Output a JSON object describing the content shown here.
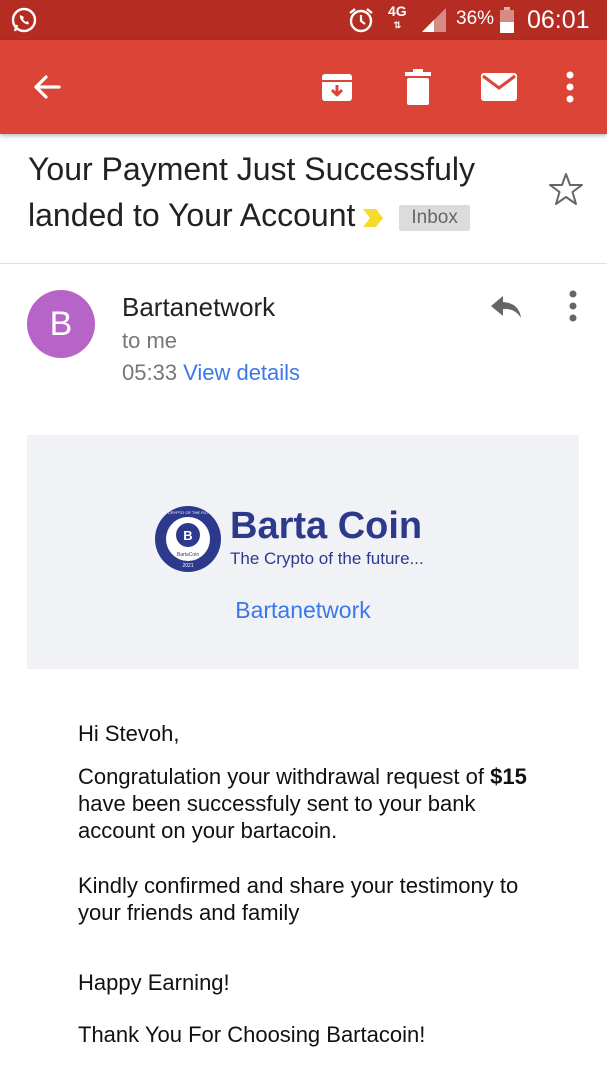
{
  "status_bar": {
    "network": "4G",
    "battery_percent": "36%",
    "time": "06:01"
  },
  "toolbar": {
    "back_icon": "arrow-back-icon",
    "archive_icon": "archive-icon",
    "delete_icon": "trash-icon",
    "mark_unread_icon": "mail-icon",
    "more_icon": "more-vert-icon"
  },
  "email": {
    "subject": "Your Payment Just Successfuly landed to Your Account",
    "label": "Inbox",
    "sender_initial": "B",
    "sender_name": "Bartanetwork",
    "recipient": "to me",
    "time": "05:33",
    "view_details": "View details"
  },
  "banner": {
    "brand_name": "Barta Coin",
    "tagline": "The Crypto of the future...",
    "link": "Bartanetwork",
    "seal_text_top": "THE CRYPTO OF THE FUTURE",
    "seal_text_mid": "BartaCoin",
    "seal_year": "2021"
  },
  "body": {
    "greeting": "Hi Stevoh,",
    "p1_before": "Congratulation your withdrawal request of",
    "p1_amount": "$15",
    "p1_after": "have been successfuly sent to your bank account on your bartacoin.",
    "p2": "Kindly confirmed and share your testimony to your friends and family",
    "p3": "Happy Earning!",
    "p4": "Thank You For Choosing Bartacoin!"
  },
  "colors": {
    "status_bar": "#b52c22",
    "app_bar": "#db4437",
    "avatar": "#b764c9",
    "link": "#3b78e7",
    "brand": "#2d3a8c"
  }
}
